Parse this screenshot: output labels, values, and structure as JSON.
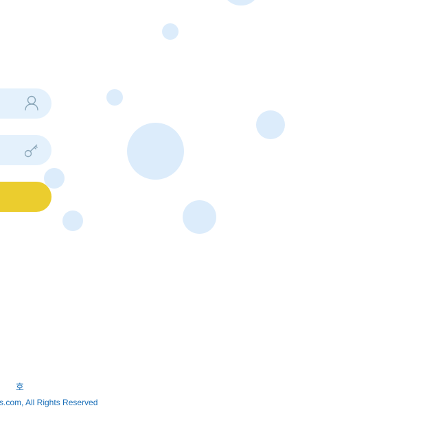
{
  "login": {
    "username_icon": "user-icon",
    "password_icon": "key-icon",
    "submit_color": "#ebcd2e"
  },
  "footer": {
    "line1": "        호",
    "copyright": "s.com, All Rights Reserved"
  },
  "colors": {
    "bubble": "#dcecfb",
    "field_bg": "#e4f1fc",
    "icon_stroke": "#8aa6b8",
    "footer_text": "#1a6fb8"
  }
}
